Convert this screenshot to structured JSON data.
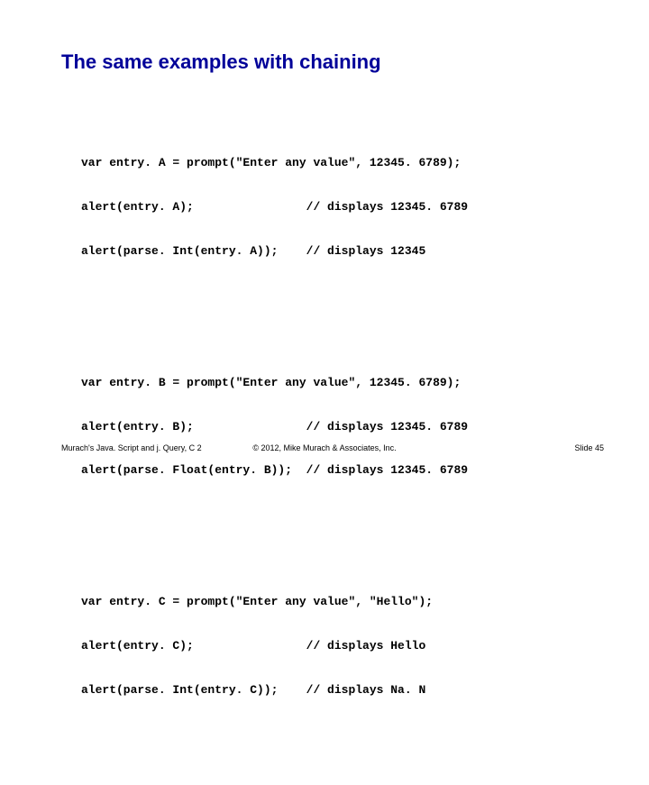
{
  "slide": {
    "title": "The same examples with chaining",
    "code_blocks": [
      {
        "lines": [
          "var entry. A = prompt(\"Enter any value\", 12345. 6789);",
          "alert(entry. A);                // displays 12345. 6789",
          "alert(parse. Int(entry. A));    // displays 12345"
        ]
      },
      {
        "lines": [
          "var entry. B = prompt(\"Enter any value\", 12345. 6789);",
          "alert(entry. B);                // displays 12345. 6789",
          "alert(parse. Float(entry. B));  // displays 12345. 6789"
        ]
      },
      {
        "lines": [
          "var entry. C = prompt(\"Enter any value\", \"Hello\");",
          "alert(entry. C);                // displays Hello",
          "alert(parse. Int(entry. C));    // displays Na. N"
        ]
      }
    ],
    "footer": {
      "left": "Murach's Java. Script and j. Query, C 2",
      "center": "© 2012, Mike Murach & Associates, Inc.",
      "right": "Slide 45"
    }
  }
}
